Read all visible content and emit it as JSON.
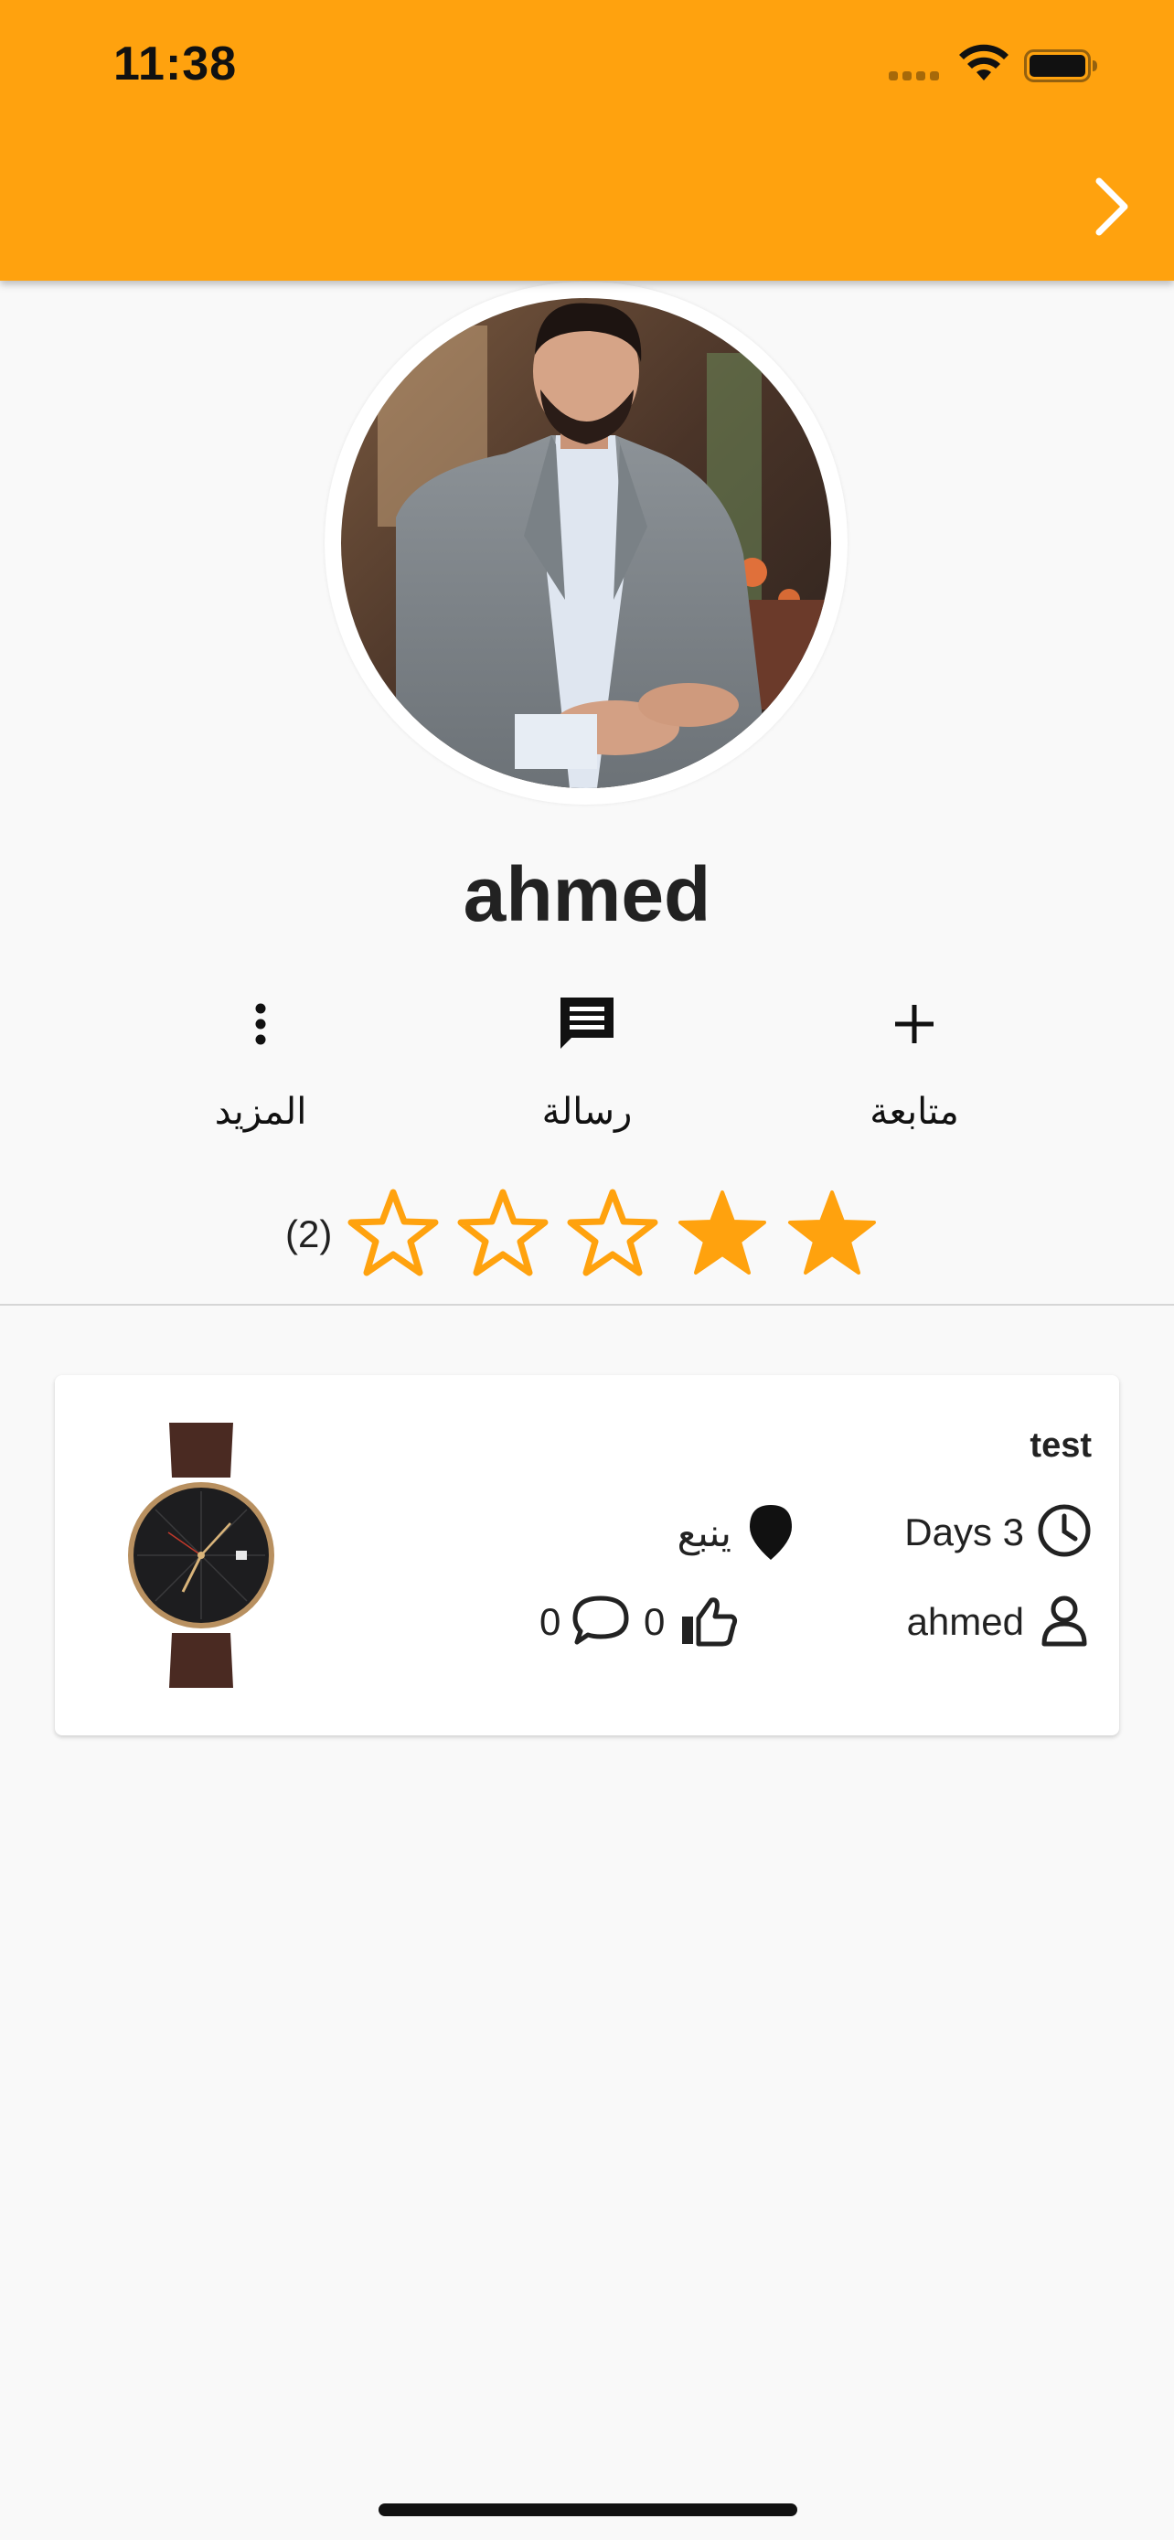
{
  "status_bar": {
    "time": "11:38",
    "icons": [
      "signal-icon",
      "wifi-icon",
      "battery-icon"
    ]
  },
  "app_bar": {
    "background": "#FFA20E",
    "back_icon": "chevron-right-icon"
  },
  "profile": {
    "name": "ahmed",
    "avatar": "profile-photo"
  },
  "actions": [
    {
      "label": "المزيد",
      "icon": "more-vertical-icon"
    },
    {
      "label": "رسالة",
      "icon": "message-icon"
    },
    {
      "label": "متابعة",
      "icon": "plus-icon"
    }
  ],
  "rating": {
    "count_label": "(2)",
    "value": 2,
    "max": 5,
    "star_color": "#FFA20E"
  },
  "listings": [
    {
      "title": "test",
      "time_ago": "Days 3",
      "location": "ينبع",
      "seller": "ahmed",
      "likes": "0",
      "comments": "0",
      "image": "wristwatch-photo"
    }
  ]
}
